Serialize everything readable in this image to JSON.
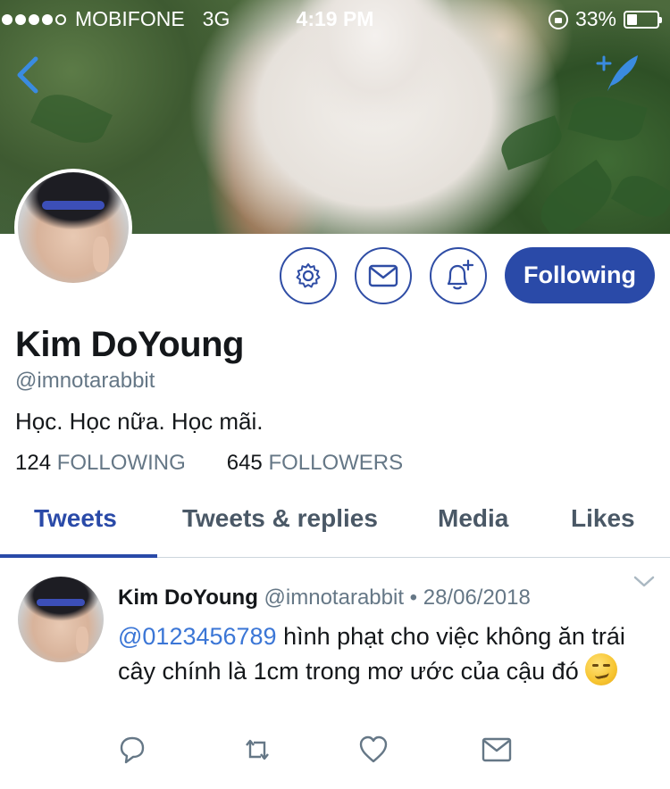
{
  "status_bar": {
    "carrier": "MOBIFONE",
    "network": "3G",
    "time": "4:19 PM",
    "battery": "33%",
    "battery_level": 0.33,
    "signal_bars": 4
  },
  "profile": {
    "name": "Kim DoYoung",
    "handle": "@imnotarabbit",
    "bio": "Học. Học nữa. Học mãi.",
    "following_count": "124",
    "following_label": "FOLLOWING",
    "followers_count": "645",
    "followers_label": "FOLLOWERS",
    "follow_button_label": "Following"
  },
  "tabs": [
    {
      "label": "Tweets",
      "active": true
    },
    {
      "label": "Tweets & replies",
      "active": false
    },
    {
      "label": "Media",
      "active": false
    },
    {
      "label": "Likes",
      "active": false
    }
  ],
  "tweet": {
    "author_name": "Kim DoYoung",
    "author_handle": "@imnotarabbit",
    "separator": "•",
    "date": "28/06/2018",
    "mention": "@0123456789",
    "text_after_mention": " hình phạt cho việc không ăn trái cây chính là 1cm trong mơ ước của cậu đó ",
    "emoji": "smirking-face"
  },
  "icons": {
    "back": "back-chevron-icon",
    "compose": "compose-tweet-icon",
    "settings": "gear-icon",
    "message": "envelope-icon",
    "notify": "bell-plus-icon",
    "more": "chevron-down-icon",
    "reply": "reply-icon",
    "retweet": "retweet-icon",
    "like": "heart-icon",
    "dm": "envelope-icon"
  },
  "colors": {
    "accent": "#2a4aa8",
    "link": "#3b76d6",
    "muted": "#657786"
  }
}
